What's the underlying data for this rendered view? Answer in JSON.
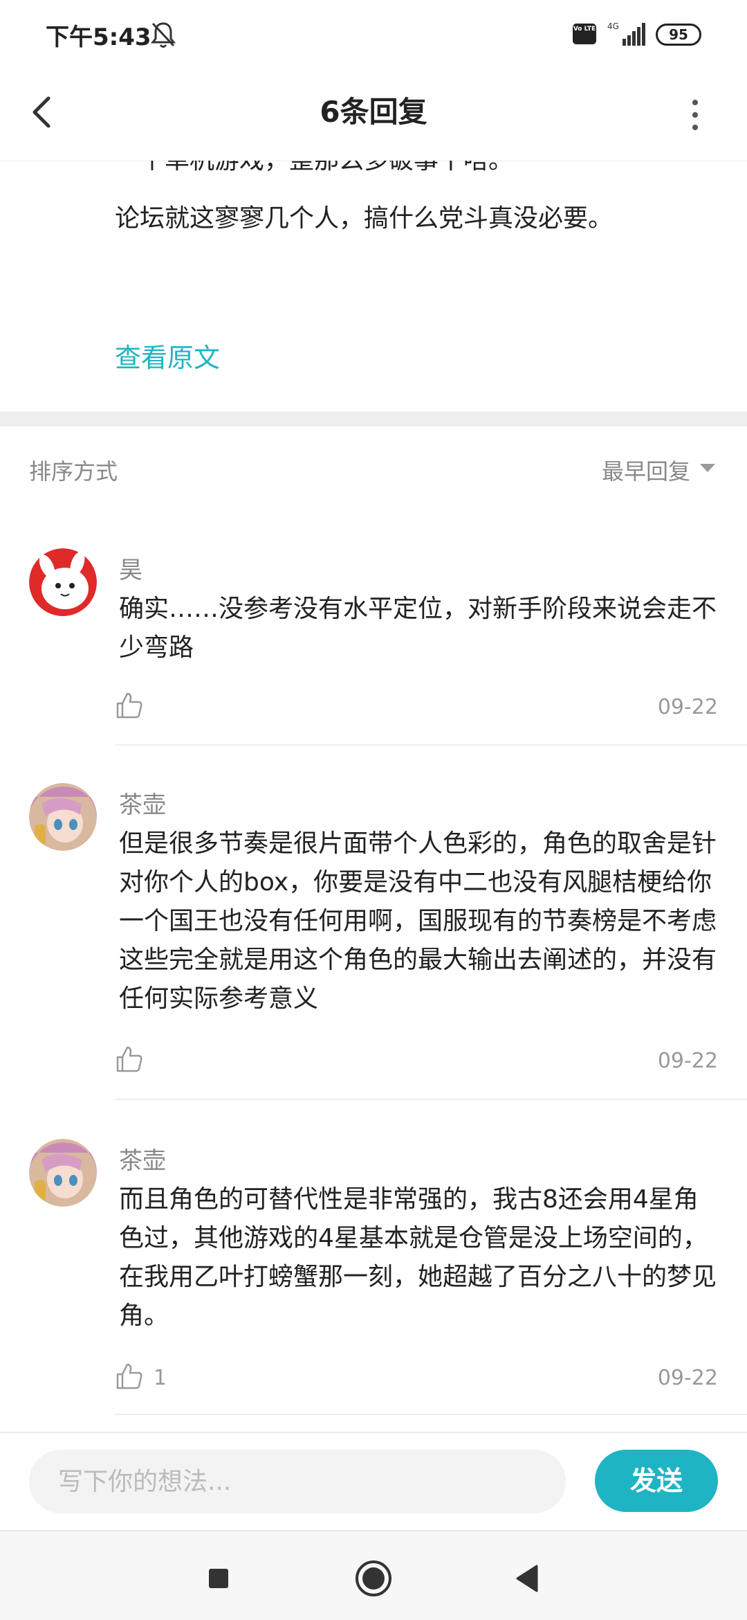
{
  "status_bar": {
    "time": "下午5:43",
    "network_badge": "Vo LTE",
    "network_type": "4G",
    "battery": "95",
    "icons": [
      "bell-off-icon",
      "signal-icon",
      "battery-icon"
    ]
  },
  "header": {
    "title": "6条回复",
    "icons": [
      "back-arrow-icon",
      "more-vertical-icon"
    ]
  },
  "original_post": {
    "partial_line": "一个单机游戏，整那么多破事干嗒。",
    "last_line": "论坛就这寥寥几个人，搞什么党斗真没必要。",
    "view_original": "查看原文"
  },
  "sort": {
    "label": "排序方式",
    "value": "最早回复",
    "icon": "caret-down-icon"
  },
  "replies": [
    {
      "author": "昊",
      "content": "确实……没参考没有水平定位，对新手阶段来说会走不少弯路",
      "likes": "",
      "date": "09-22"
    },
    {
      "author": "茶壶",
      "content": "但是很多节奏是很片面带个人色彩的，角色的取舍是针对你个人的box，你要是没有中二也没有风腿桔梗给你一个国王也没有任何用啊，国服现有的节奏榜是不考虑这些完全就是用这个角色的最大输出去阐述的，并没有任何实际参考意义",
      "likes": "",
      "date": "09-22"
    },
    {
      "author": "茶壶",
      "content": "而且角色的可替代性是非常强的，我古8还会用4星角色过，其他游戏的4星基本就是仓管是没上场空间的，在我用乙叶打螃蟹那一刻，她超越了百分之八十的梦见角。",
      "likes": "1",
      "date": "09-22"
    }
  ],
  "composer": {
    "placeholder": "写下你的想法...",
    "value": "",
    "send_label": "发送"
  },
  "nav": {
    "icons": [
      "recents-square-icon",
      "home-circle-icon",
      "back-triangle-icon"
    ]
  },
  "colors": {
    "accent": "#1fb4c4",
    "text_primary": "#222222",
    "text_secondary": "#888888",
    "divider": "#efefef"
  }
}
